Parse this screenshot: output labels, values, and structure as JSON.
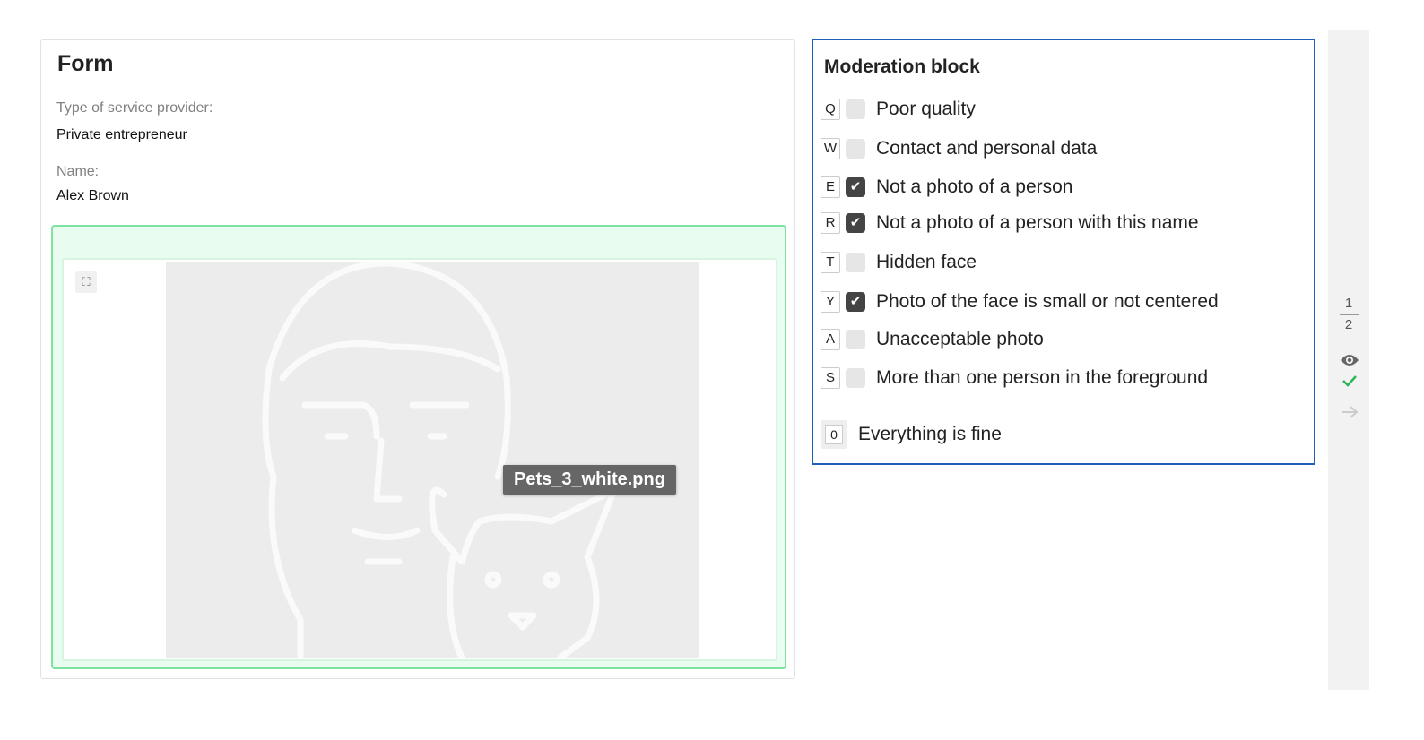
{
  "form": {
    "title": "Form",
    "fields": [
      {
        "label": "Type of service provider:",
        "value": "Private entrepreneur"
      },
      {
        "label": "Name:",
        "value": "Alex Brown"
      }
    ],
    "image": {
      "filename": "Pets_3_white.png",
      "expand_icon": "expand-icon"
    }
  },
  "moderation": {
    "title": "Moderation block",
    "items": [
      {
        "key": "Q",
        "label": "Poor quality",
        "checked": false
      },
      {
        "key": "W",
        "label": "Contact and personal data",
        "checked": false
      },
      {
        "key": "E",
        "label": "Not a photo of a person",
        "checked": true
      },
      {
        "key": "R",
        "label": "Not a photo of a person with this name",
        "checked": true
      },
      {
        "key": "T",
        "label": "Hidden face",
        "checked": false
      },
      {
        "key": "Y",
        "label": "Photo of the face is small or not centered",
        "checked": true
      },
      {
        "key": "A",
        "label": "Unacceptable photo",
        "checked": false
      },
      {
        "key": "S",
        "label": "More than one person in the foreground",
        "checked": false
      }
    ],
    "fine": {
      "key": "0",
      "label": "Everything is fine"
    },
    "accent": "#1f5fb8"
  },
  "sidebar": {
    "current": "1",
    "total": "2",
    "icons": [
      "eye-icon",
      "check-icon",
      "arrow-right-icon"
    ],
    "check_color": "#2db55d"
  }
}
